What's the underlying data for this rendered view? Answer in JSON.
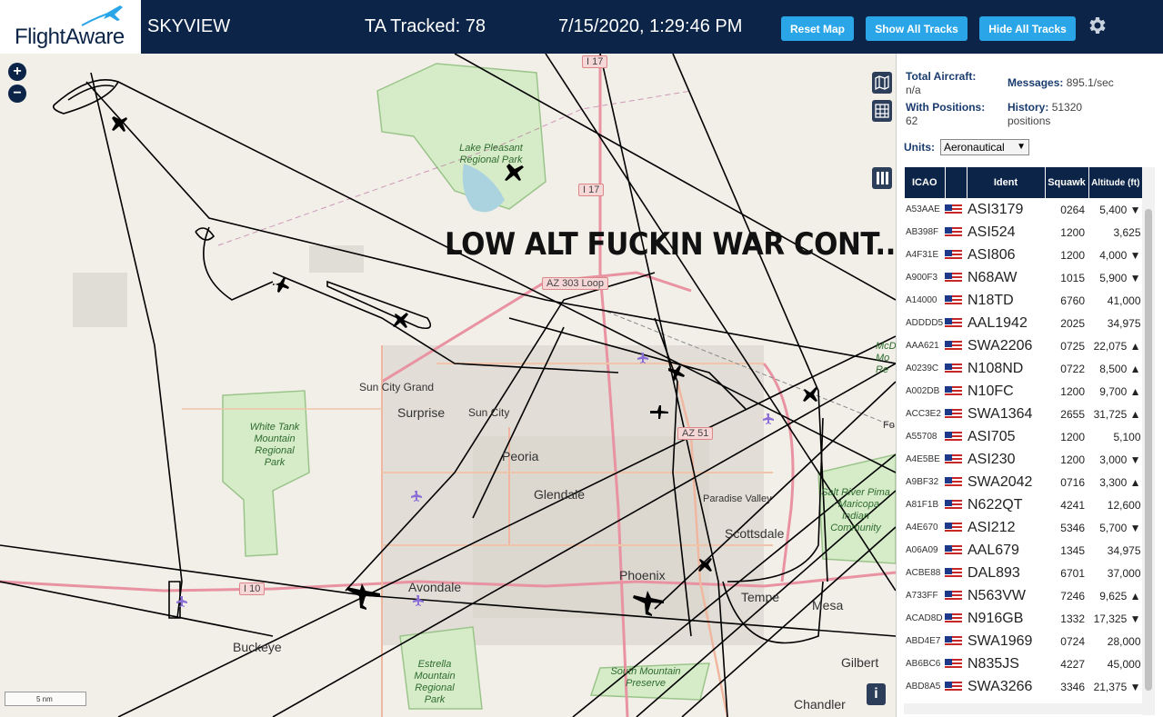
{
  "header": {
    "logo": "FlightAware",
    "app_name": "SKYVIEW",
    "tracked": "TA Tracked: 78",
    "datetime": "7/15/2020, 1:29:46 PM",
    "buttons": {
      "reset": "Reset Map",
      "show_all": "Show All Tracks",
      "hide_all": "Hide All Tracks"
    }
  },
  "map": {
    "overlay_text": "LOW ALT FUCKIN WAR CONT...",
    "zoom_in": "+",
    "zoom_out": "−",
    "scale": "5 nm",
    "info": "i",
    "places": [
      "Sun City Grand",
      "Surprise",
      "Sun City",
      "Peoria",
      "Glendale",
      "Paradise Valley",
      "Scottsdale",
      "Phoenix",
      "Avondale",
      "Tempe",
      "Mesa",
      "Buckeye",
      "Gilbert",
      "Chandler",
      "Fo"
    ],
    "parks": [
      "Lake Pleasant Regional Park",
      "White Tank Mountain Regional Park",
      "Estrella Mountain Regional Park",
      "South Mountain Preserve",
      "Salt River Pima - Maricopa Indian Community",
      "McD Mo Re"
    ],
    "roads": [
      "I 17",
      "I 17",
      "AZ 303 Loop",
      "AZ 51",
      "I 10"
    ]
  },
  "sidebar": {
    "total_aircraft_label": "Total Aircraft:",
    "total_aircraft_value": "n/a",
    "messages_label": "Messages:",
    "messages_value": "895.1/sec",
    "with_positions_label": "With Positions:",
    "with_positions_value": "62",
    "history_label": "History:",
    "history_value": "51320 positions",
    "units_label": "Units:",
    "units_value": "Aeronautical",
    "columns": [
      "ICAO",
      "",
      "Ident",
      "Squawk",
      "Altitude (ft)"
    ],
    "rows": [
      {
        "icao": "A53AAE",
        "ident": "ASI3179",
        "squawk": "0264",
        "alt": "5,400 ▼"
      },
      {
        "icao": "AB398F",
        "ident": "ASI524",
        "squawk": "1200",
        "alt": "3,625"
      },
      {
        "icao": "A4F31E",
        "ident": "ASI806",
        "squawk": "1200",
        "alt": "4,000 ▼"
      },
      {
        "icao": "A900F3",
        "ident": "N68AW",
        "squawk": "1015",
        "alt": "5,900 ▼"
      },
      {
        "icao": "A14000",
        "ident": "N18TD",
        "squawk": "6760",
        "alt": "41,000"
      },
      {
        "icao": "ADDDD5",
        "ident": "AAL1942",
        "squawk": "2025",
        "alt": "34,975"
      },
      {
        "icao": "AAA621",
        "ident": "SWA2206",
        "squawk": "0725",
        "alt": "22,075 ▲"
      },
      {
        "icao": "A0239C",
        "ident": "N108ND",
        "squawk": "0722",
        "alt": "8,500 ▲"
      },
      {
        "icao": "A002DB",
        "ident": "N10FC",
        "squawk": "1200",
        "alt": "9,700 ▲"
      },
      {
        "icao": "ACC3E2",
        "ident": "SWA1364",
        "squawk": "2655",
        "alt": "31,725 ▲"
      },
      {
        "icao": "A55708",
        "ident": "ASI705",
        "squawk": "1200",
        "alt": "5,100"
      },
      {
        "icao": "A4E5BE",
        "ident": "ASI230",
        "squawk": "1200",
        "alt": "3,000 ▼"
      },
      {
        "icao": "A9BF32",
        "ident": "SWA2042",
        "squawk": "0716",
        "alt": "3,300 ▲"
      },
      {
        "icao": "A81F1B",
        "ident": "N622QT",
        "squawk": "4241",
        "alt": "12,600"
      },
      {
        "icao": "A4E670",
        "ident": "ASI212",
        "squawk": "5346",
        "alt": "5,700 ▼"
      },
      {
        "icao": "A06A09",
        "ident": "AAL679",
        "squawk": "1345",
        "alt": "34,975"
      },
      {
        "icao": "ACBE88",
        "ident": "DAL893",
        "squawk": "6701",
        "alt": "37,000"
      },
      {
        "icao": "A733FF",
        "ident": "N563VW",
        "squawk": "7246",
        "alt": "9,625 ▲"
      },
      {
        "icao": "ACAD8D",
        "ident": "N916GB",
        "squawk": "1332",
        "alt": "17,325 ▼"
      },
      {
        "icao": "ABD4E7",
        "ident": "SWA1969",
        "squawk": "0724",
        "alt": "28,000"
      },
      {
        "icao": "AB6BC6",
        "ident": "N835JS",
        "squawk": "4227",
        "alt": "45,000"
      },
      {
        "icao": "ABD8A5",
        "ident": "SWA3266",
        "squawk": "3346",
        "alt": "21,375 ▼"
      }
    ]
  }
}
